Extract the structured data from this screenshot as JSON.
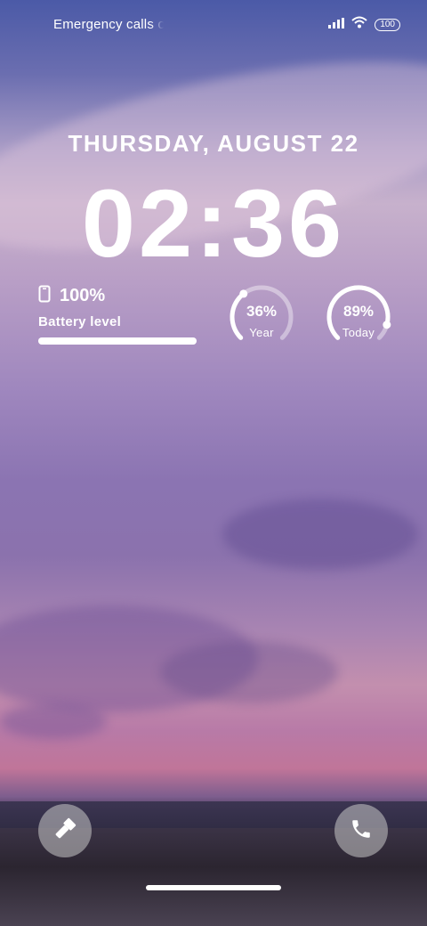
{
  "status_bar": {
    "left_text": "Emergency calls only",
    "battery": "100"
  },
  "lockscreen": {
    "date": "THURSDAY, AUGUST 22",
    "time": "02:36"
  },
  "battery_widget": {
    "percent": "100%",
    "label": "Battery level",
    "level": 1.0
  },
  "progress_rings": [
    {
      "value": "36%",
      "label": "Year",
      "fraction": 0.36
    },
    {
      "value": "89%",
      "label": "Today",
      "fraction": 0.89
    }
  ],
  "shortcuts": {
    "left_icon": "flashlight-icon",
    "right_icon": "phone-icon"
  }
}
